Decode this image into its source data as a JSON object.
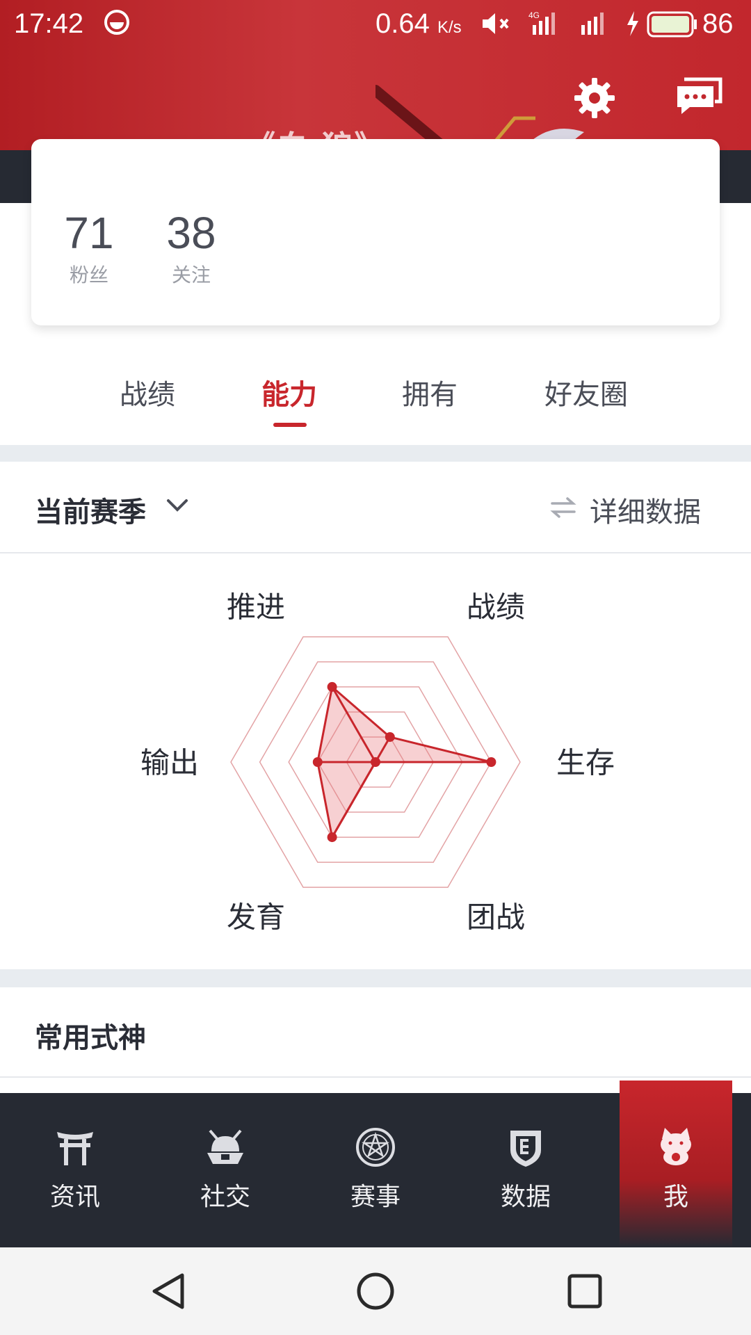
{
  "status_bar": {
    "time": "17:42",
    "net_speed": "0.64",
    "net_speed_unit": "K/s",
    "network_label": "4G",
    "battery_percent": "86"
  },
  "profile": {
    "name": "《白·狼》",
    "fans_count": "71",
    "fans_label": "粉丝",
    "following_count": "38",
    "following_label": "关注"
  },
  "tabs": [
    {
      "label": "战绩",
      "active": false
    },
    {
      "label": "能力",
      "active": true
    },
    {
      "label": "拥有",
      "active": false
    },
    {
      "label": "好友圈",
      "active": false
    }
  ],
  "season": {
    "label": "当前赛季",
    "detail_label": "详细数据"
  },
  "radar": {
    "axes": [
      "战绩",
      "生存",
      "团战",
      "发育",
      "输出",
      "推进"
    ],
    "values": [
      0.2,
      0.8,
      0.0,
      0.6,
      0.4,
      0.6
    ],
    "levels": 5,
    "color": "#c8262c",
    "grid_color": "#e3a3a5"
  },
  "common_shikigami": {
    "title": "常用式神"
  },
  "bottom_nav": [
    {
      "label": "资讯",
      "icon": "torii-gate-icon",
      "active": false
    },
    {
      "label": "社交",
      "icon": "samurai-helmet-icon",
      "active": false
    },
    {
      "label": "赛事",
      "icon": "pentagram-icon",
      "active": false
    },
    {
      "label": "数据",
      "icon": "shield-icon",
      "active": false
    },
    {
      "label": "我",
      "icon": "lucky-cat-icon",
      "active": true
    }
  ],
  "colors": {
    "brand_red": "#c8262c",
    "nav_dark": "#262a33"
  }
}
